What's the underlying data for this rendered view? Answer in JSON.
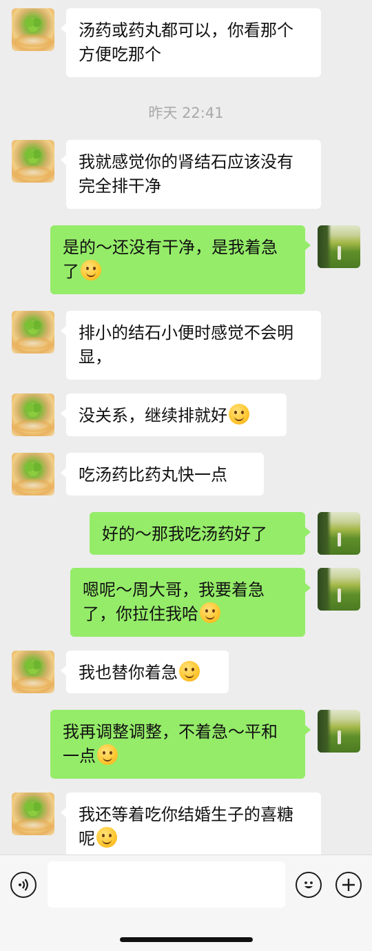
{
  "chat": {
    "timestamp": "昨天 22:41",
    "messages": [
      {
        "from": "peer",
        "text": "汤药或药丸都可以，你看那个方便吃那个",
        "emoji": ""
      },
      {
        "from": "peer",
        "text": "我就感觉你的肾结石应该没有完全排干净",
        "emoji": ""
      },
      {
        "from": "self",
        "text": "是的～还没有干净，是我着急了",
        "emoji": "laugh-cry-emoji"
      },
      {
        "from": "peer",
        "text": "排小的结石小便时感觉不会明显，",
        "emoji": ""
      },
      {
        "from": "peer",
        "text": "没关系，继续排就好",
        "emoji": "smile-emoji"
      },
      {
        "from": "peer",
        "text": "吃汤药比药丸快一点",
        "emoji": ""
      },
      {
        "from": "self",
        "text": "好的～那我吃汤药好了",
        "emoji": ""
      },
      {
        "from": "self",
        "text": "嗯呢～周大哥，我要着急了，你拉住我哈",
        "emoji": "tears-of-joy-emoji"
      },
      {
        "from": "peer",
        "text": "我也替你着急",
        "emoji": "thinking-emoji"
      },
      {
        "from": "self",
        "text": "我再调整调整，不着急～平和一点",
        "emoji": "crying-emoji"
      },
      {
        "from": "peer",
        "text": "我还等着吃你结婚生子的喜糖呢",
        "emoji": "smile-emoji"
      }
    ]
  },
  "input_bar": {
    "voice_icon": "voice-icon",
    "emoji_icon": "emoji-icon",
    "plus_icon": "plus-icon",
    "placeholder": ""
  }
}
